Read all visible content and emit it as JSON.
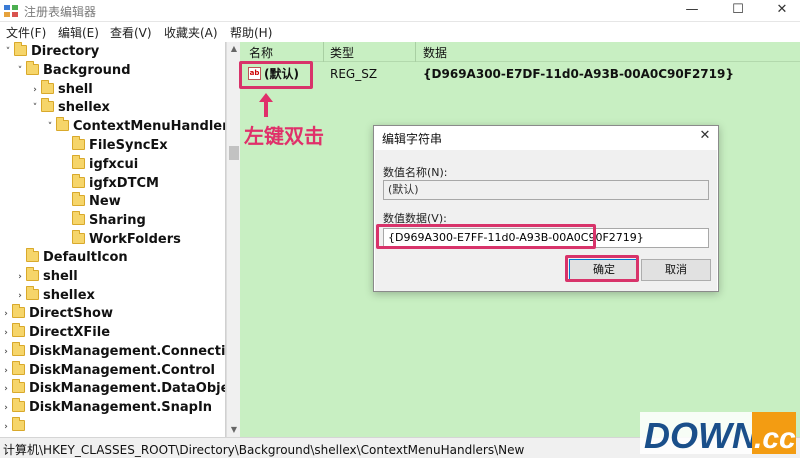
{
  "window": {
    "title": "注册表编辑器",
    "controls": {
      "minimize": "—",
      "maximize": "☐",
      "close": "✕"
    }
  },
  "menu": [
    "文件(F)",
    "编辑(E)",
    "查看(V)",
    "收藏夹(A)",
    "帮助(H)"
  ],
  "tree": {
    "items": [
      {
        "label": "Directory",
        "toggle": "˅"
      },
      {
        "label": "Background",
        "toggle": "˅"
      },
      {
        "label": "shell",
        "toggle": "›"
      },
      {
        "label": "shellex",
        "toggle": "˅"
      },
      {
        "label": "ContextMenuHandlers",
        "toggle": "˅"
      },
      {
        "label": "FileSyncEx",
        "toggle": ""
      },
      {
        "label": "igfxcui",
        "toggle": ""
      },
      {
        "label": "igfxDTCM",
        "toggle": ""
      },
      {
        "label": "New",
        "toggle": ""
      },
      {
        "label": "Sharing",
        "toggle": ""
      },
      {
        "label": "WorkFolders",
        "toggle": ""
      },
      {
        "label": "DefaultIcon",
        "toggle": ""
      },
      {
        "label": "shell",
        "toggle": "›"
      },
      {
        "label": "shellex",
        "toggle": "›"
      },
      {
        "label": "DirectShow",
        "toggle": "›"
      },
      {
        "label": "DirectXFile",
        "toggle": "›"
      },
      {
        "label": "DiskManagement.Connection",
        "toggle": "›"
      },
      {
        "label": "DiskManagement.Control",
        "toggle": "›"
      },
      {
        "label": "DiskManagement.DataObject",
        "toggle": "›"
      },
      {
        "label": "DiskManagement.SnapIn",
        "toggle": "›"
      },
      {
        "label": "",
        "toggle": "›"
      }
    ]
  },
  "list": {
    "columns": {
      "name": "名称",
      "type": "类型",
      "data": "数据"
    },
    "rows": [
      {
        "icon": "ab",
        "name": "(默认)",
        "type": "REG_SZ",
        "data": "{D969A300-E7DF-11d0-A93B-00A0C90F2719}"
      }
    ]
  },
  "annotation": {
    "text": "左键双击",
    "color": "#e0306a"
  },
  "dialog": {
    "title": "编辑字符串",
    "close": "✕",
    "name_label": "数值名称(N):",
    "name_value": "(默认)",
    "data_label": "数值数据(V):",
    "data_value": "{D969A300-E7FF-11d0-A93B-00A0C90F2719}",
    "ok_label": "确定",
    "cancel_label": "取消"
  },
  "statusbar": {
    "path": "计算机\\HKEY_CLASSES_ROOT\\Directory\\Background\\shellex\\ContextMenuHandlers\\New"
  },
  "watermark": {
    "text": "DOWN.cc"
  },
  "colors": {
    "list_bg": "#c8efc2",
    "highlight": "#d8336a",
    "folder": "#f6d56a"
  }
}
